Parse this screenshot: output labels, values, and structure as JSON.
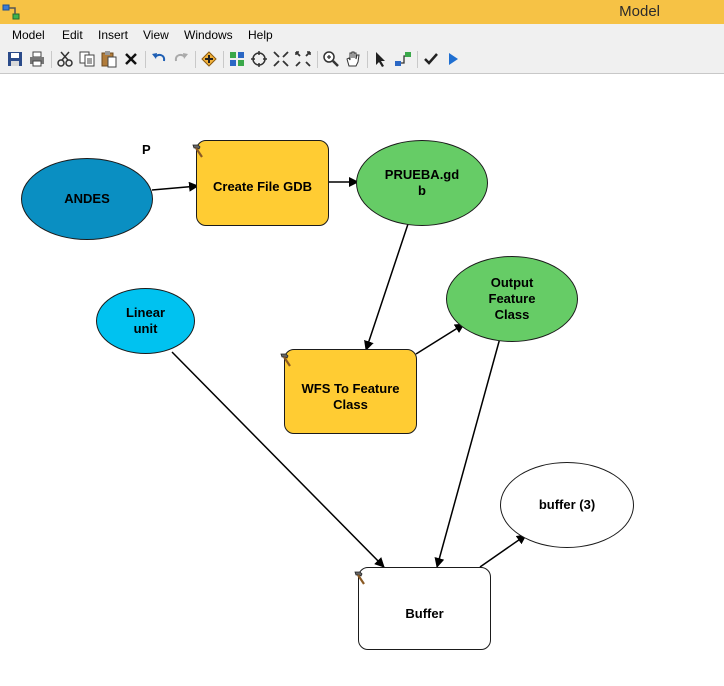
{
  "window": {
    "title": "Model"
  },
  "menu": [
    "Model",
    "Edit",
    "Insert",
    "View",
    "Windows",
    "Help"
  ],
  "toolbar": {
    "buttons": [
      "save-icon",
      "print-icon",
      "cut-icon",
      "copy-icon",
      "paste-icon",
      "delete-icon",
      "undo-icon",
      "redo-icon",
      "add-data-icon",
      "auto-layout-icon",
      "full-extent-icon",
      "fixed-zoom-in-icon",
      "fixed-zoom-out-icon",
      "zoom-in-icon",
      "pan-icon",
      "select-icon",
      "connect-icon",
      "validate-icon",
      "run-icon"
    ]
  },
  "model": {
    "nodes": {
      "andes": {
        "label": "ANDES",
        "type": "variable",
        "color": "#0a8fc2"
      },
      "andes_tag": {
        "label": "P"
      },
      "create_gdb": {
        "label": "Create File GDB",
        "type": "tool",
        "color": "#ffcc33"
      },
      "prueba": {
        "label": "PRUEBA.gd\nb",
        "type": "output",
        "color": "#66cc66"
      },
      "linear_unit": {
        "label": "Linear\nunit",
        "type": "variable",
        "color": "#00c2f0"
      },
      "wfs_tool": {
        "label": "WFS To Feature\nClass",
        "type": "tool",
        "color": "#ffcc33"
      },
      "output_fc": {
        "label": "Output\nFeature\nClass",
        "type": "output",
        "color": "#66cc66"
      },
      "buffer_out": {
        "label": "buffer (3)",
        "type": "output",
        "color": "#ffffff"
      },
      "buffer_tool": {
        "label": "Buffer",
        "type": "tool",
        "color": "#ffffff"
      }
    }
  }
}
